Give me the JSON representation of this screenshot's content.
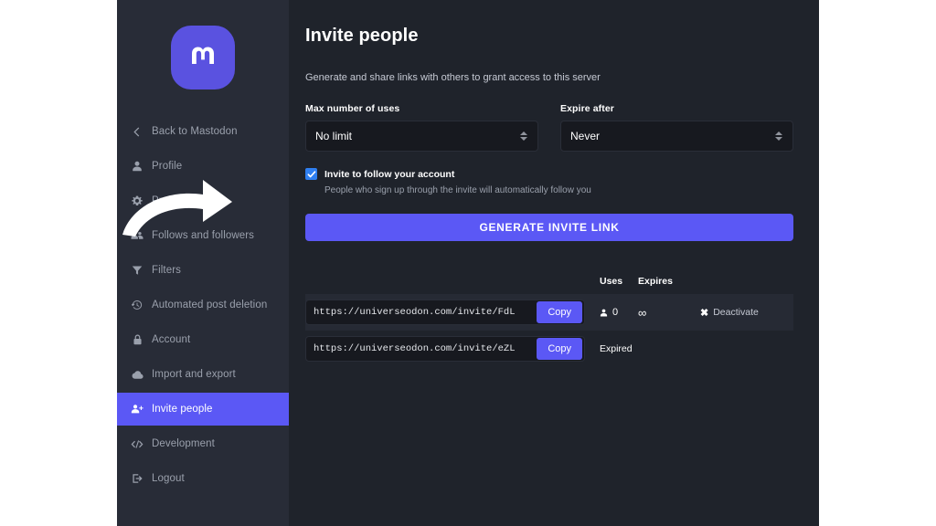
{
  "sidebar": {
    "logo_name": "mastodon-logo",
    "items": [
      {
        "label": "Back to Mastodon",
        "icon": "chevron-left-icon",
        "key": "back-to-mastodon",
        "active": false
      },
      {
        "label": "Profile",
        "icon": "person-icon",
        "key": "profile",
        "active": false
      },
      {
        "label": "Preferences",
        "icon": "gear-icon",
        "key": "preferences",
        "active": false
      },
      {
        "label": "Follows and followers",
        "icon": "people-group-icon",
        "key": "follows-and-followers",
        "active": false
      },
      {
        "label": "Filters",
        "icon": "funnel-icon",
        "key": "filters",
        "active": false
      },
      {
        "label": "Automated post deletion",
        "icon": "history-clock-icon",
        "key": "automated-post-deletion",
        "active": false
      },
      {
        "label": "Account",
        "icon": "lock-icon",
        "key": "account",
        "active": false
      },
      {
        "label": "Import and export",
        "icon": "cloud-icon",
        "key": "import-and-export",
        "active": false
      },
      {
        "label": "Invite people",
        "icon": "person-plus-icon",
        "key": "invite-people",
        "active": true
      },
      {
        "label": "Development",
        "icon": "code-brackets-icon",
        "key": "development",
        "active": false
      },
      {
        "label": "Logout",
        "icon": "sign-out-icon",
        "key": "logout",
        "active": false
      }
    ]
  },
  "main": {
    "title": "Invite people",
    "description": "Generate and share links with others to grant access to this server",
    "fields": {
      "max_uses": {
        "label": "Max number of uses",
        "value": "No limit"
      },
      "expire_after": {
        "label": "Expire after",
        "value": "Never"
      }
    },
    "checkbox": {
      "label": "Invite to follow your account",
      "hint": "People who sign up through the invite will automatically follow you",
      "checked": true
    },
    "generate_button": "GENERATE INVITE LINK",
    "table": {
      "headers": {
        "link": "",
        "uses": "Uses",
        "expires": "Expires",
        "actions": ""
      },
      "rows": [
        {
          "url": "https://universeodon.com/invite/FdL",
          "copy_label": "Copy",
          "uses": "0",
          "expires": "∞",
          "action_label": "Deactivate",
          "status": ""
        },
        {
          "url": "https://universeodon.com/invite/eZL",
          "copy_label": "Copy",
          "uses": "",
          "expires": "",
          "action_label": "",
          "status": "Expired"
        }
      ]
    }
  },
  "annotation": {
    "name": "curved-arrow-pointing-to-checkbox"
  },
  "colors": {
    "accent": "#5b58f5",
    "checkbox": "#2f7ff0",
    "sidebar_bg": "#282c37",
    "content_bg": "#1f232b",
    "input_bg": "#17191f"
  }
}
